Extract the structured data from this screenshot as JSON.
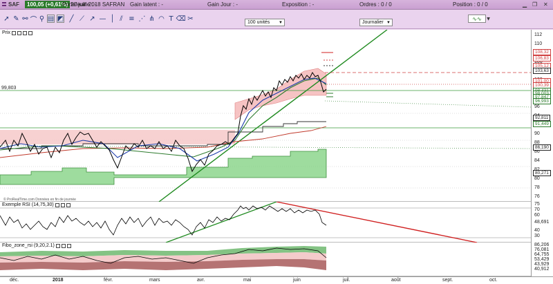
{
  "titlebar": {
    "instrument": "SAF",
    "price_badge": "100,05 (+0,61%)",
    "date_name": "20 juin 2018 SAFRAN",
    "portefeuille": "Portefeuille",
    "portefeuille_value": "-",
    "gain_latent": "Gain latent",
    "gain_latent_value": "-",
    "gain_jour": "Gain Jour",
    "gain_jour_value": "-",
    "exposition": "Exposition",
    "exposition_value": "-",
    "ordres": "Ordres",
    "ordres_value": "0",
    "ordres_value2": "0",
    "position": "Position",
    "position_value": "0",
    "position_value2": "0"
  },
  "toolbar": {
    "quantity": "100 unités",
    "timeframe": "Journalier"
  },
  "price_panel": {
    "title": "Prix",
    "hline_label": "99,803",
    "watermark": "© ProRealTime.com Données en fin de journée",
    "ticks": [
      "112",
      "110",
      "108",
      "106",
      "104",
      "102",
      "100",
      "98",
      "96",
      "94",
      "92",
      "90",
      "88",
      "86",
      "84",
      "82",
      "80",
      "78",
      "76"
    ],
    "tags": [
      {
        "label": "108,32",
        "color": "#d04040",
        "bg": "#fff"
      },
      {
        "label": "106,83",
        "color": "#d04040",
        "bg": "#fff"
      },
      {
        "label": "105,12",
        "color": "#d04040",
        "bg": "#fff"
      },
      {
        "label": "103,63",
        "color": "#222",
        "bg": "#fff"
      },
      {
        "label": "101,00",
        "color": "#d04040",
        "bg": "#fff"
      },
      {
        "label": "100,39",
        "color": "#d04040",
        "bg": "#fff"
      },
      {
        "label": "98,431",
        "color": "#2a7a2a",
        "bg": "#fff"
      },
      {
        "label": "98,003",
        "color": "#2a7a2a",
        "bg": "#fff"
      },
      {
        "label": "97,847",
        "color": "#2a7a2a",
        "bg": "#fff"
      },
      {
        "label": "96,993",
        "color": "#2a7a2a",
        "bg": "#fff"
      },
      {
        "label": "92,811",
        "color": "#222",
        "bg": "#fff"
      },
      {
        "label": "91,449",
        "color": "#2a7a2a",
        "bg": "#fff"
      },
      {
        "label": "86,190",
        "color": "#222",
        "bg": "#fff"
      },
      {
        "label": "80,271",
        "color": "#222",
        "bg": "#fff"
      }
    ]
  },
  "rsi_panel": {
    "title": "Exemple RSI (14,75,30)",
    "ticks": [
      "75",
      "70",
      "60",
      "48,691",
      "40",
      "30"
    ]
  },
  "fibo_panel": {
    "title": "Fibo_zone_rsi (9,20,2.1)",
    "ticks": [
      "86,206",
      "76,081",
      "64,755",
      "53,429",
      "43,929",
      "40,912"
    ]
  },
  "xaxis": {
    "labels": [
      "déc.",
      "2018",
      "févr.",
      "mars",
      "avr.",
      "mai",
      "juin",
      "juil.",
      "août",
      "sept.",
      "oct."
    ]
  }
}
